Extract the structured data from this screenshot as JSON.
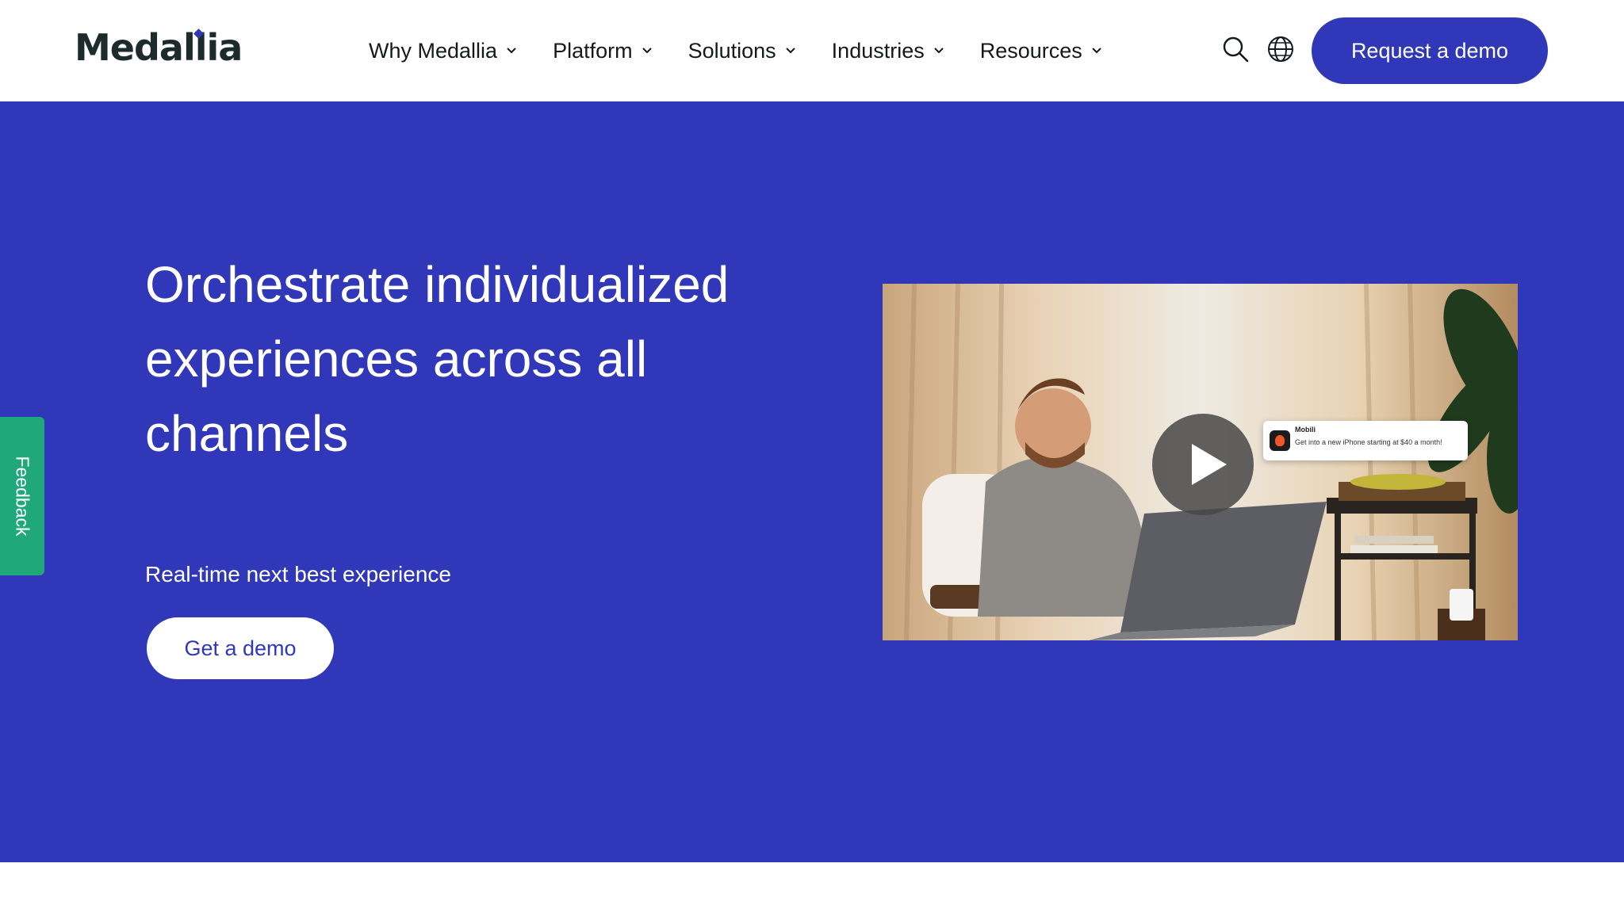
{
  "header": {
    "logo_text": "Medallia",
    "nav": [
      {
        "label": "Why Medallia"
      },
      {
        "label": "Platform"
      },
      {
        "label": "Solutions"
      },
      {
        "label": "Industries"
      },
      {
        "label": "Resources"
      }
    ],
    "icons": [
      "search-icon",
      "globe-icon"
    ],
    "cta_label": "Request a demo"
  },
  "hero": {
    "title": "Orchestrate individualized experiences across all channels",
    "subtitle": "Real-time next best experience",
    "cta_label": "Get a demo",
    "video": {
      "notification_title": "Mobili",
      "notification_text": "Get into a new iPhone starting at $40 a month!"
    }
  },
  "feedback_tab": {
    "label": "Feedback"
  },
  "colors": {
    "brand": "#3037b8",
    "feedback": "#1fa97a",
    "text_dark": "#141a1c",
    "white": "#ffffff"
  }
}
